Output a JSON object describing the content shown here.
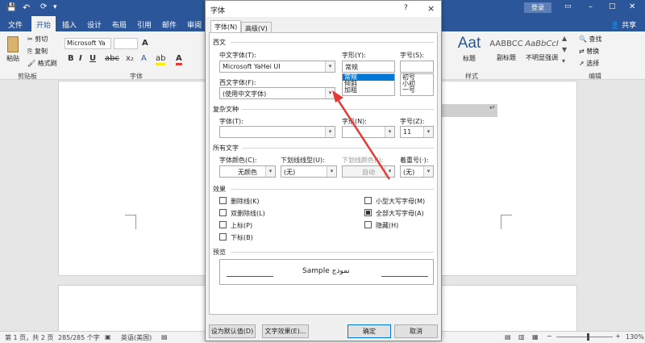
{
  "titlebar": {
    "login_label": "登录",
    "help_label": "?",
    "close_label": "✕"
  },
  "tabs": [
    "文件",
    "开始",
    "插入",
    "设计",
    "布局",
    "引用",
    "邮件",
    "审阅"
  ],
  "share_label": "共享",
  "ribbon": {
    "clipboard": {
      "paste": "粘贴",
      "cut": "剪切",
      "copy": "复制",
      "painter": "格式刷",
      "group": "剪贴板"
    },
    "font": {
      "font_name": "Microsoft Ya",
      "font_size": "",
      "group": "字体"
    },
    "styles": {
      "items": [
        {
          "preview": "Aat",
          "name": "标题"
        },
        {
          "preview": "AABBCC",
          "name": "副标题"
        },
        {
          "preview": "AaBbCcI",
          "name": "不明显强调"
        }
      ],
      "group": "样式"
    },
    "editing": {
      "find": "查找",
      "replace": "替换",
      "select": "选择",
      "group": "编辑"
    }
  },
  "status": {
    "page": "第 1 页，共 2 页",
    "words": "285/285 个字",
    "language": "英语(美国)",
    "zoom": "130%"
  },
  "dialog": {
    "title": "字体",
    "help": "?",
    "close": "×",
    "tabs": [
      "字体(N)",
      "高级(V)"
    ],
    "western": {
      "section": "西文",
      "cn_font_label": "中文字体(T):",
      "cn_font_value": "Microsoft YaHei UI",
      "west_font_label": "西文字体(F):",
      "west_font_value": "(使用中文字体)",
      "style_label": "字形(Y):",
      "style_value": "常规",
      "style_options": [
        "常规",
        "倾斜",
        "加粗"
      ],
      "size_label": "字号(S):",
      "size_value": "",
      "size_options": [
        "初号",
        "小初",
        "一号"
      ]
    },
    "complex": {
      "section": "复杂文种",
      "font_label": "字体(T):",
      "font_value": "",
      "style_label": "字形(N):",
      "style_value": "",
      "size_label": "字号(Z):",
      "size_value": "11"
    },
    "all": {
      "section": "所有文字",
      "color_label": "字体颜色(C):",
      "color_value": "无颜色",
      "underline_label": "下划线线型(U):",
      "underline_value": "(无)",
      "ucolor_label": "下划线颜色(I):",
      "ucolor_value": "自动",
      "emph_label": "着重号(·):",
      "emph_value": "(无)"
    },
    "effects": {
      "section": "效果",
      "left": [
        {
          "label": "删除线(K)",
          "checked": false
        },
        {
          "label": "双删除线(L)",
          "checked": false
        },
        {
          "label": "上标(P)",
          "checked": false
        },
        {
          "label": "下标(B)",
          "checked": false
        }
      ],
      "right": [
        {
          "label": "小型大写字母(M)",
          "checked": false
        },
        {
          "label": "全部大写字母(A)",
          "checked": true
        },
        {
          "label": "隐藏(H)",
          "checked": false
        }
      ]
    },
    "preview": {
      "section": "预览",
      "text": "Sample نموذج"
    },
    "buttons": {
      "default": "设为默认值(D)",
      "text_effects": "文字效果(E)...",
      "ok": "确定",
      "cancel": "取消"
    }
  },
  "colors": {
    "brand": "#2b579a",
    "arrow": "#e53935",
    "accent": "#0078d7"
  }
}
